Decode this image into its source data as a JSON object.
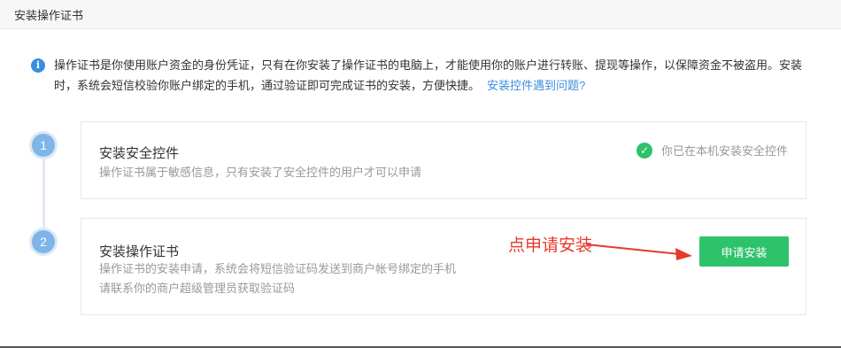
{
  "header": {
    "title": "安装操作证书"
  },
  "info": {
    "text": "操作证书是你使用账户资金的身份凭证，只有在你安装了操作证书的电脑上，才能使用你的账户进行转账、提现等操作，以保障资金不被盗用。安装时，系统会短信校验你账户绑定的手机，通过验证即可完成证书的安装，方便快捷。",
    "link": "安装控件遇到问题?"
  },
  "steps": [
    {
      "number": "1",
      "title": "安装安全控件",
      "desc": "操作证书属于敏感信息，只有安装了安全控件的用户才可以申请",
      "status": "你已在本机安装安全控件"
    },
    {
      "number": "2",
      "title": "安装操作证书",
      "desc_line1": "操作证书的安装申请，系统会将短信验证码发送到商户帐号绑定的手机",
      "desc_line2": "请联系你的商户超级管理员获取验证码",
      "button": "申请安装"
    }
  ],
  "annotation": {
    "text": "点申请安装",
    "color": "#e8392b"
  },
  "colors": {
    "accent": "#3b8de0",
    "success": "#2ec26a"
  },
  "icons": {
    "info": "info-icon",
    "check": "check-circle-icon"
  }
}
